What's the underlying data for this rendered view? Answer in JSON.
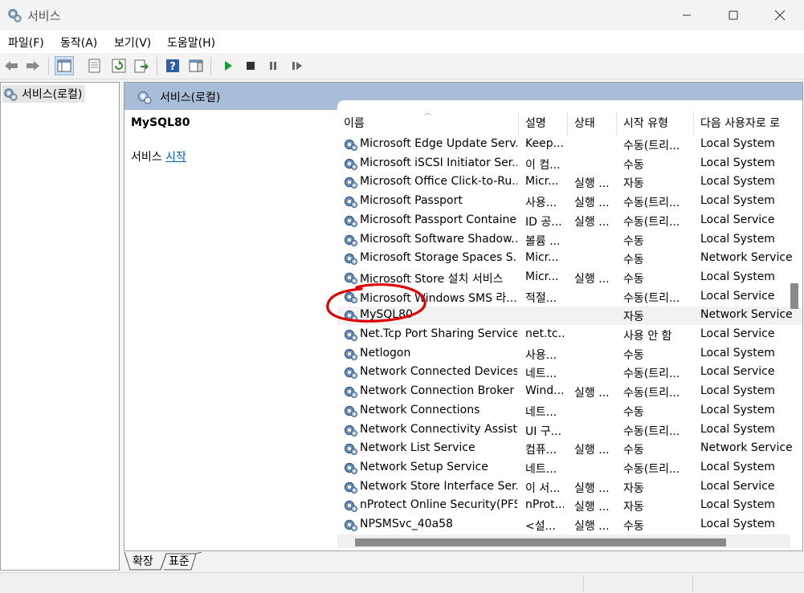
{
  "window": {
    "title": "서비스"
  },
  "menu": [
    "파일(F)",
    "동작(A)",
    "보기(V)",
    "도움말(H)"
  ],
  "tree": {
    "root_label": "서비스(로컬)"
  },
  "main": {
    "header_title": "서비스(로컬)",
    "selected_service": "MySQL80",
    "action_prefix": "서비스 ",
    "action_link": "시작"
  },
  "columns": [
    "이름",
    "설명",
    "상태",
    "시작 유형",
    "다음 사용자로 로"
  ],
  "rows": [
    {
      "name": "Microsoft Edge Update Serv...",
      "desc": "Keep...",
      "status": "",
      "startup": "수동(트리...",
      "logon": "Local System"
    },
    {
      "name": "Microsoft iSCSI Initiator Ser...",
      "desc": "이 컴...",
      "status": "",
      "startup": "수동",
      "logon": "Local System"
    },
    {
      "name": "Microsoft Office Click-to-Ru...",
      "desc": "Micr...",
      "status": "실행 ...",
      "startup": "자동",
      "logon": "Local System"
    },
    {
      "name": "Microsoft Passport",
      "desc": "사용...",
      "status": "실행 ...",
      "startup": "수동(트리...",
      "logon": "Local System"
    },
    {
      "name": "Microsoft Passport Container",
      "desc": "ID 공...",
      "status": "실행 ...",
      "startup": "수동(트리...",
      "logon": "Local Service"
    },
    {
      "name": "Microsoft Software Shadow...",
      "desc": "볼륨 ...",
      "status": "",
      "startup": "수동",
      "logon": "Local System"
    },
    {
      "name": "Microsoft Storage Spaces S...",
      "desc": "Micr...",
      "status": "",
      "startup": "수동",
      "logon": "Network Service"
    },
    {
      "name": "Microsoft Store 설치 서비스",
      "desc": "Micr...",
      "status": "실행 ...",
      "startup": "수동",
      "logon": "Local System"
    },
    {
      "name": "Microsoft Windows SMS 라...",
      "desc": "적절...",
      "status": "",
      "startup": "수동(트리...",
      "logon": "Local Service"
    },
    {
      "name": "MySQL80",
      "desc": "",
      "status": "",
      "startup": "자동",
      "logon": "Network Service"
    },
    {
      "name": "Net.Tcp Port Sharing Service",
      "desc": "net.tc...",
      "status": "",
      "startup": "사용 안 함",
      "logon": "Local Service"
    },
    {
      "name": "Netlogon",
      "desc": "사용...",
      "status": "",
      "startup": "수동",
      "logon": "Local System"
    },
    {
      "name": "Network Connected Devices...",
      "desc": "네트...",
      "status": "",
      "startup": "수동(트리...",
      "logon": "Local Service"
    },
    {
      "name": "Network Connection Broker",
      "desc": "Wind...",
      "status": "실행 ...",
      "startup": "수동(트리...",
      "logon": "Local System"
    },
    {
      "name": "Network Connections",
      "desc": "네트...",
      "status": "",
      "startup": "수동",
      "logon": "Local System"
    },
    {
      "name": "Network Connectivity Assist...",
      "desc": "UI 구...",
      "status": "",
      "startup": "수동(트리...",
      "logon": "Local System"
    },
    {
      "name": "Network List Service",
      "desc": "컴퓨...",
      "status": "실행 ...",
      "startup": "수동",
      "logon": "Network Service"
    },
    {
      "name": "Network Setup Service",
      "desc": "네트...",
      "status": "",
      "startup": "수동(트리...",
      "logon": "Local System"
    },
    {
      "name": "Network Store Interface Ser...",
      "desc": "이 서...",
      "status": "실행 ...",
      "startup": "자동",
      "logon": "Local Service"
    },
    {
      "name": "nProtect Online Security(PFS)",
      "desc": "nProt...",
      "status": "실행 ...",
      "startup": "자동",
      "logon": "Local System"
    },
    {
      "name": "NPSMSvc_40a58",
      "desc": "<설...",
      "status": "실행 ...",
      "startup": "수동",
      "logon": "Local System"
    }
  ],
  "tabs": [
    "확장",
    "표준"
  ],
  "colors": {
    "header_band": "#a7bdd8",
    "link": "#0063b1",
    "annotation": "#e00000"
  }
}
